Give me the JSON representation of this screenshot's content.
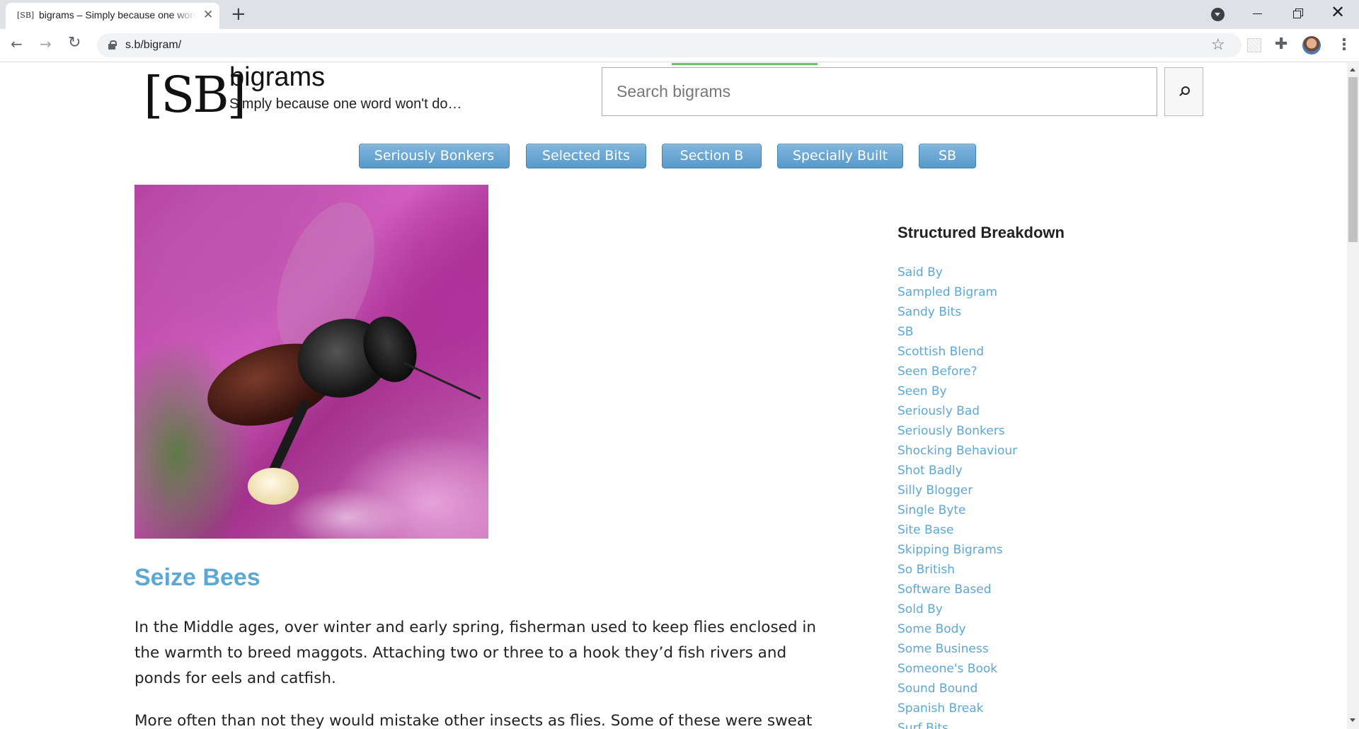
{
  "browser": {
    "favicon_text": "[SB]",
    "tab_title": "bigrams – Simply because one word won't do...",
    "url": "s.b/bigram/"
  },
  "site": {
    "logo_text": "[SB]",
    "title": "bigrams",
    "tagline": "Simply because one word won't do…"
  },
  "search": {
    "placeholder": "Search bigrams",
    "value": ""
  },
  "nav": {
    "items": [
      "Seriously Bonkers",
      "Selected Bits",
      "Section B",
      "Specially Built",
      "SB"
    ]
  },
  "post": {
    "image_alt": "Sweat bee carrying pollen on a pink flower",
    "title": "Seize Bees",
    "paragraphs": [
      "In the Middle ages, over winter and early spring, fisherman used to keep flies enclosed in the warmth to breed maggots. Attaching two or three to a hook they’d fish rivers and ponds for eels and catfish.",
      "More often than not they would mistake other insects as flies. Some of these were sweat bees and"
    ]
  },
  "sidebar": {
    "heading": "Structured Breakdown",
    "items": [
      "Said By",
      "Sampled Bigram",
      "Sandy Bits",
      "SB",
      "Scottish Blend",
      "Seen Before?",
      "Seen By",
      "Seriously Bad",
      "Seriously Bonkers",
      "Shocking Behaviour",
      "Shot Badly",
      "Silly Blogger",
      "Single Byte",
      "Site Base",
      "Skipping Bigrams",
      "So British",
      "Software Based",
      "Sold By",
      "Some Body",
      "Some Business",
      "Someone's Book",
      "Sound Bound",
      "Spanish Break",
      "Surf Bits"
    ]
  },
  "colors": {
    "link": "#5ca8d4",
    "nav_pill": "#6aa7d3",
    "page_background": "#ffffff"
  }
}
